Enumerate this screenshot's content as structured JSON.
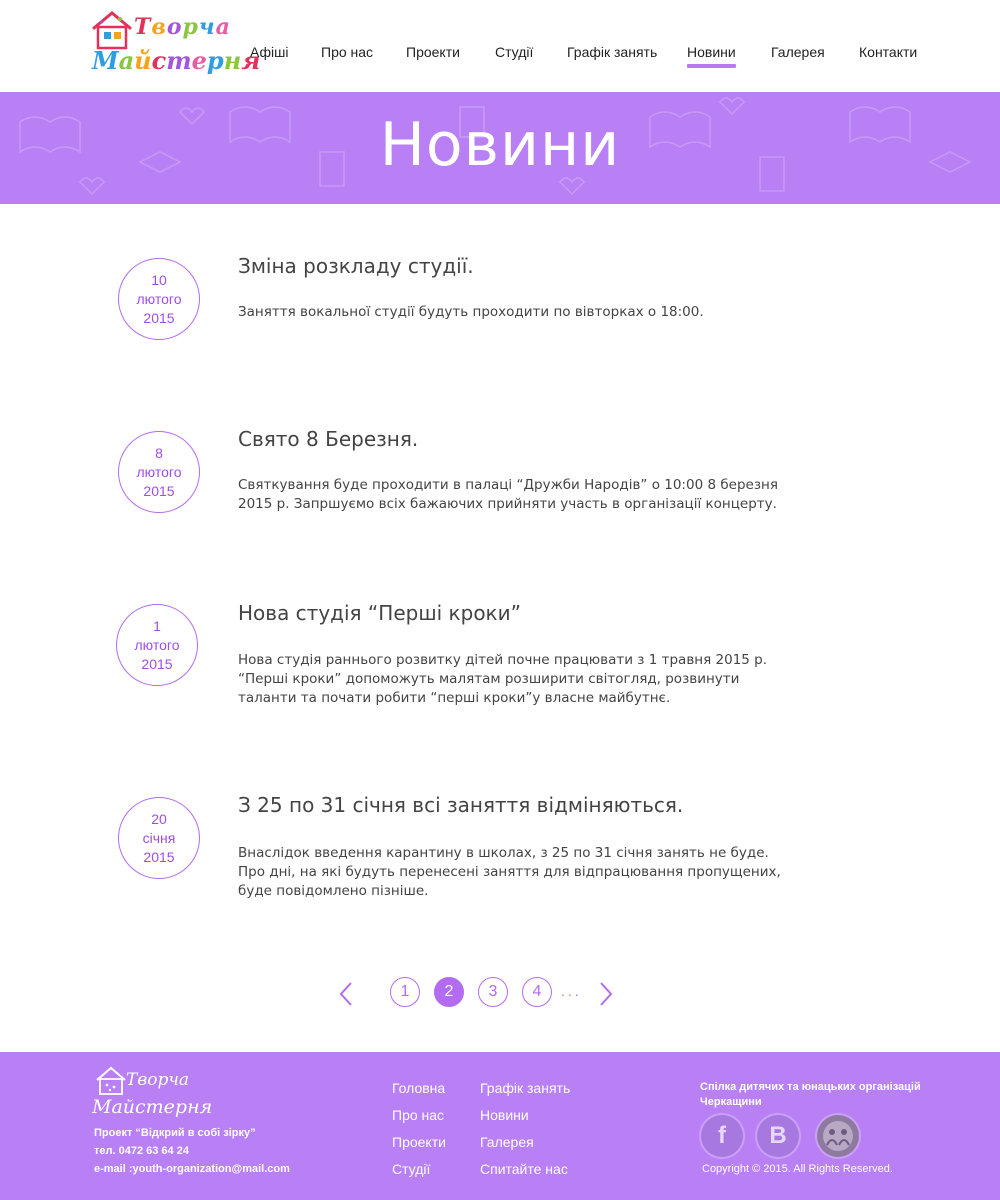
{
  "logo": {
    "line1": "Творча",
    "line2": "Майстерня"
  },
  "nav": [
    {
      "label": "Афіші"
    },
    {
      "label": "Про нас"
    },
    {
      "label": "Проекти"
    },
    {
      "label": "Студії"
    },
    {
      "label": "Графік занять"
    },
    {
      "label": "Новини",
      "active": true
    },
    {
      "label": "Галерея"
    },
    {
      "label": "Контакти"
    }
  ],
  "banner": {
    "title": "Новини"
  },
  "news": [
    {
      "day": "10",
      "month": "лютого",
      "year": "2015",
      "title": "Зміна розкладу студії.",
      "text": "Заняття вокальної студії будуть проходити по вівторках о 18:00."
    },
    {
      "day": "8",
      "month": "лютого",
      "year": "2015",
      "title": "Свято 8 Березня.",
      "text": "Святкування буде проходити в палаці “Дружби Народів” о 10:00 8 березня 2015 р. Запршуємо всіх бажаючих прийняти участь в організації концерту."
    },
    {
      "day": "1",
      "month": "лютого",
      "year": "2015",
      "title": "Нова студія “Перші кроки”",
      "text": "Нова студія раннього розвитку дітей почне працювати з 1 травня 2015 р. “Перші кроки” допоможуть малятам розширити світогляд, розвинути таланти та почати робити “перші кроки”у власне майбутнє."
    },
    {
      "day": "20",
      "month": "січня",
      "year": "2015",
      "title": "З 25 по 31 січня всі заняття відміняються.",
      "text": "Внаслідок введення карантину в школах, з 25 по 31 січня занять не буде. Про дні, на які будуть перенесені заняття для відпрацювання пропущених, буде повідомлено пізніше."
    }
  ],
  "pagination": {
    "pages": [
      "1",
      "2",
      "3",
      "4"
    ],
    "current": "2",
    "ellipsis": "..."
  },
  "footer": {
    "logo_line1": "Творча",
    "logo_line2": "Майстерня",
    "project": "Проект “Відкрий в собі зірку”",
    "phone": "тел. 0472 63 64 24",
    "email": "e-mail :youth-organization@mail.com",
    "links_col1": [
      "Головна",
      "Про нас",
      "Проекти",
      "Студії"
    ],
    "links_col2": [
      "Графік занять",
      "Новини",
      "Галерея",
      "Спитайте нас"
    ],
    "org": "Спілка дитячих та юнацьких організацій Черкащини",
    "social": [
      {
        "icon": "facebook-icon",
        "glyph": "f"
      },
      {
        "icon": "vkontakte-icon",
        "glyph": "B"
      },
      {
        "icon": "organization-emblem-icon",
        "glyph": ""
      }
    ],
    "copyright": "Copyright © 2015.  All Rights Reserved."
  },
  "colors": {
    "accent": "#b980f5",
    "accent_dark": "#a04de6",
    "text": "#444444"
  }
}
